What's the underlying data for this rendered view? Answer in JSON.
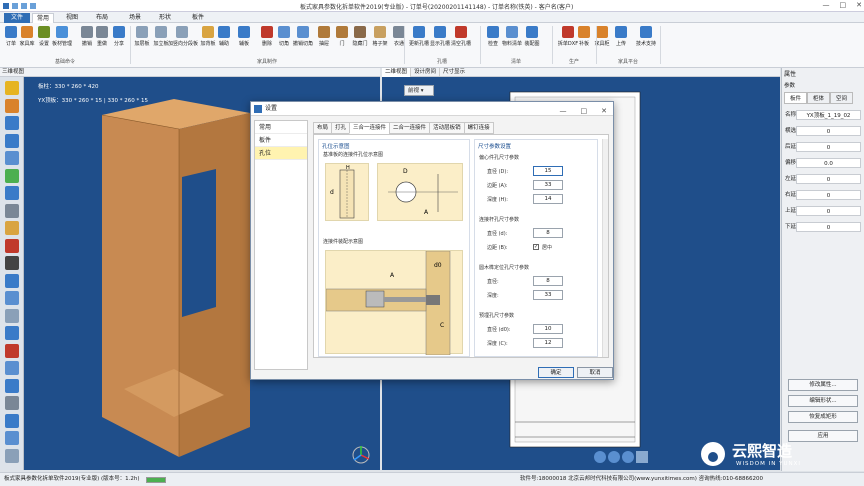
{
  "app": {
    "title": "板式家具参数化拆单软件2019(专业版) - 订单号(20200201141148) - 订单名称(铁英) - 客户名(客户)",
    "window_controls": [
      "—",
      "□",
      "✕"
    ]
  },
  "ribbon_tabs": [
    "文件",
    "常用",
    "视图",
    "布局",
    "场景",
    "形状",
    "板件"
  ],
  "ribbon": {
    "buttons": [
      "订单",
      "家具库",
      "设置",
      "板材管理",
      "撤销",
      "重做",
      "分享",
      "加层板",
      "加立板",
      "加竖向分段板",
      "加背板",
      "辅助",
      "辅板",
      "删除",
      "切角",
      "撤销切角",
      "抽屉",
      "门",
      "隐藏门",
      "格子架",
      "衣通",
      "更新孔槽",
      "显示孔槽",
      "清空孔槽",
      "检查",
      "物料清单",
      "装配图",
      "拆单DXF",
      "补板",
      "家具柜",
      "上传",
      "技术支持"
    ],
    "groups": [
      "基础命令",
      "家具制作",
      "孔槽",
      "清单",
      "生产",
      "家具平台"
    ]
  },
  "left_view": {
    "header": "三维视图",
    "info1": "板柱：330 * 260 * 420",
    "info2": "YX顶板：330 * 260 * 15 | 330 * 260 * 15"
  },
  "mid_view": {
    "tabs": [
      "二维视图",
      "设计房间",
      "尺寸显示"
    ],
    "view_select": "前视"
  },
  "dialog": {
    "title": "设置",
    "side_items": [
      "常用",
      "板件",
      "孔位"
    ],
    "tabs": [
      "布局",
      "打孔",
      "三合一连接件",
      "二合一连接件",
      "活动层板销",
      "螺钉连接"
    ],
    "left_section": {
      "title": "孔位示意图",
      "sub1": "基准板的连接件孔位示意图",
      "sub2": "连接件装配示意图"
    },
    "right_section": {
      "title": "尺寸参数设置",
      "groups": [
        {
          "title": "偏心件孔尺寸参数",
          "fields": [
            {
              "label": "直径 (D):",
              "value": "15"
            },
            {
              "label": "边距 (A):",
              "value": "33"
            },
            {
              "label": "深度 (H):",
              "value": "14"
            }
          ]
        },
        {
          "title": "连接杆孔尺寸参数",
          "fields": [
            {
              "label": "直径 (d):",
              "value": "8"
            }
          ],
          "check": {
            "label": "边距 (B):",
            "text": "居中"
          }
        },
        {
          "title": "圆木榫定位孔尺寸参数",
          "fields": [
            {
              "label": "直径:",
              "value": "8"
            },
            {
              "label": "深度:",
              "value": "33"
            }
          ]
        },
        {
          "title": "预埋孔尺寸参数",
          "fields": [
            {
              "label": "直径 (d0):",
              "value": "10"
            },
            {
              "label": "深度 (C):",
              "value": "12"
            }
          ]
        }
      ]
    },
    "ok": "确定",
    "cancel": "取消"
  },
  "properties": {
    "header": "属性",
    "section": "参数",
    "tabs": [
      "板件",
      "柜体",
      "空间"
    ],
    "rows": [
      {
        "k": "名称",
        "v": "YX顶板_1_19_02"
      },
      {
        "k": "横选",
        "v": "0"
      },
      {
        "k": "后延",
        "v": "0"
      },
      {
        "k": "偏移",
        "v": "0.0"
      },
      {
        "k": "左延",
        "v": "0"
      },
      {
        "k": "右延",
        "v": "0"
      },
      {
        "k": "上延",
        "v": "0"
      },
      {
        "k": "下延",
        "v": "0"
      }
    ],
    "buttons": [
      "修改属性...",
      "编辑形状...",
      "恢复成矩形",
      "应用"
    ]
  },
  "status": {
    "left": "板式家具参数化拆单软件2019(专业版)  (版本号：1.2h)",
    "right": "软件号:18000018 北京云邦时代科技有限公司(www.yunxitimes.com) 咨询热线:010-68866200"
  },
  "watermark": {
    "name": "云熙智造",
    "sub": "WISDOM IN YUNXI"
  },
  "colors": {
    "viewport": "#1f4e8a",
    "accent": "#2f6db5",
    "wood": "#c88a52"
  }
}
